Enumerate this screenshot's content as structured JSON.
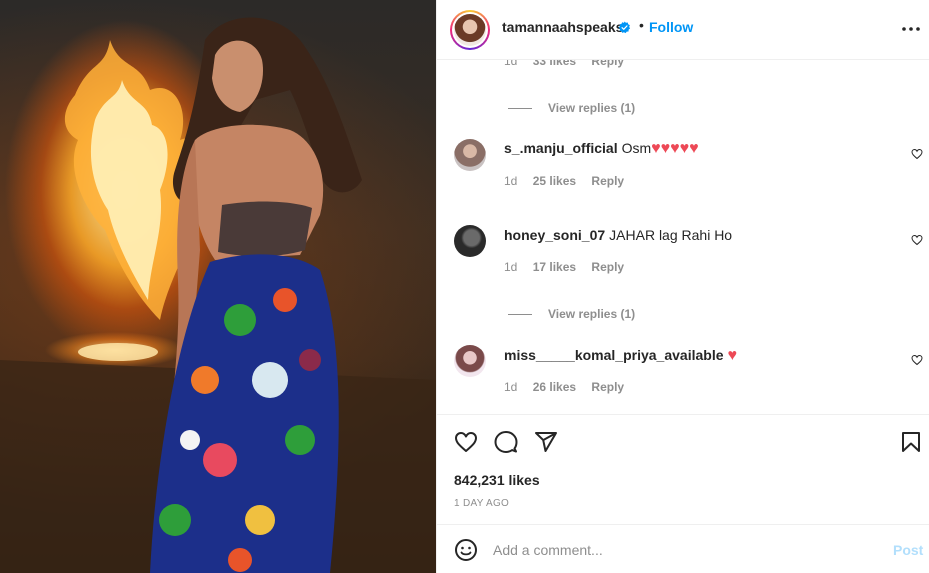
{
  "post": {
    "image_alt": "tamannaahspeaks post photo",
    "author": {
      "username": "tamannaahspeaks",
      "verified": true,
      "follow_label": "Follow",
      "separator": "•"
    }
  },
  "comments": {
    "top_partial": {
      "time": "1d",
      "likes": "33 likes",
      "reply": "Reply"
    },
    "view_replies_1": "View replies (1)",
    "items": [
      {
        "username": "s_.manju_official",
        "text": "Osm♥♥♥♥♥",
        "time": "1d",
        "likes": "25 likes",
        "reply": "Reply"
      },
      {
        "username": "honey_soni_07",
        "text": "JAHAR lag Rahi Ho",
        "time": "1d",
        "likes": "17 likes",
        "reply": "Reply"
      },
      {
        "username": "miss_____komal_priya_available",
        "text": "♥",
        "time": "1d",
        "likes": "26 likes",
        "reply": "Reply"
      }
    ],
    "view_replies_2": "View replies (1)"
  },
  "actions": {
    "icons": [
      "heart-icon",
      "comment-icon",
      "share-icon",
      "bookmark-icon"
    ],
    "likes": "842,231 likes",
    "time_ago": "1 DAY AGO"
  },
  "add_comment": {
    "placeholder": "Add a comment...",
    "post_label": "Post"
  },
  "colors": {
    "accent": "#0095f6",
    "heart": "#ed4956",
    "post_disabled": "#b2dffc",
    "muted": "#8e8e8e"
  }
}
